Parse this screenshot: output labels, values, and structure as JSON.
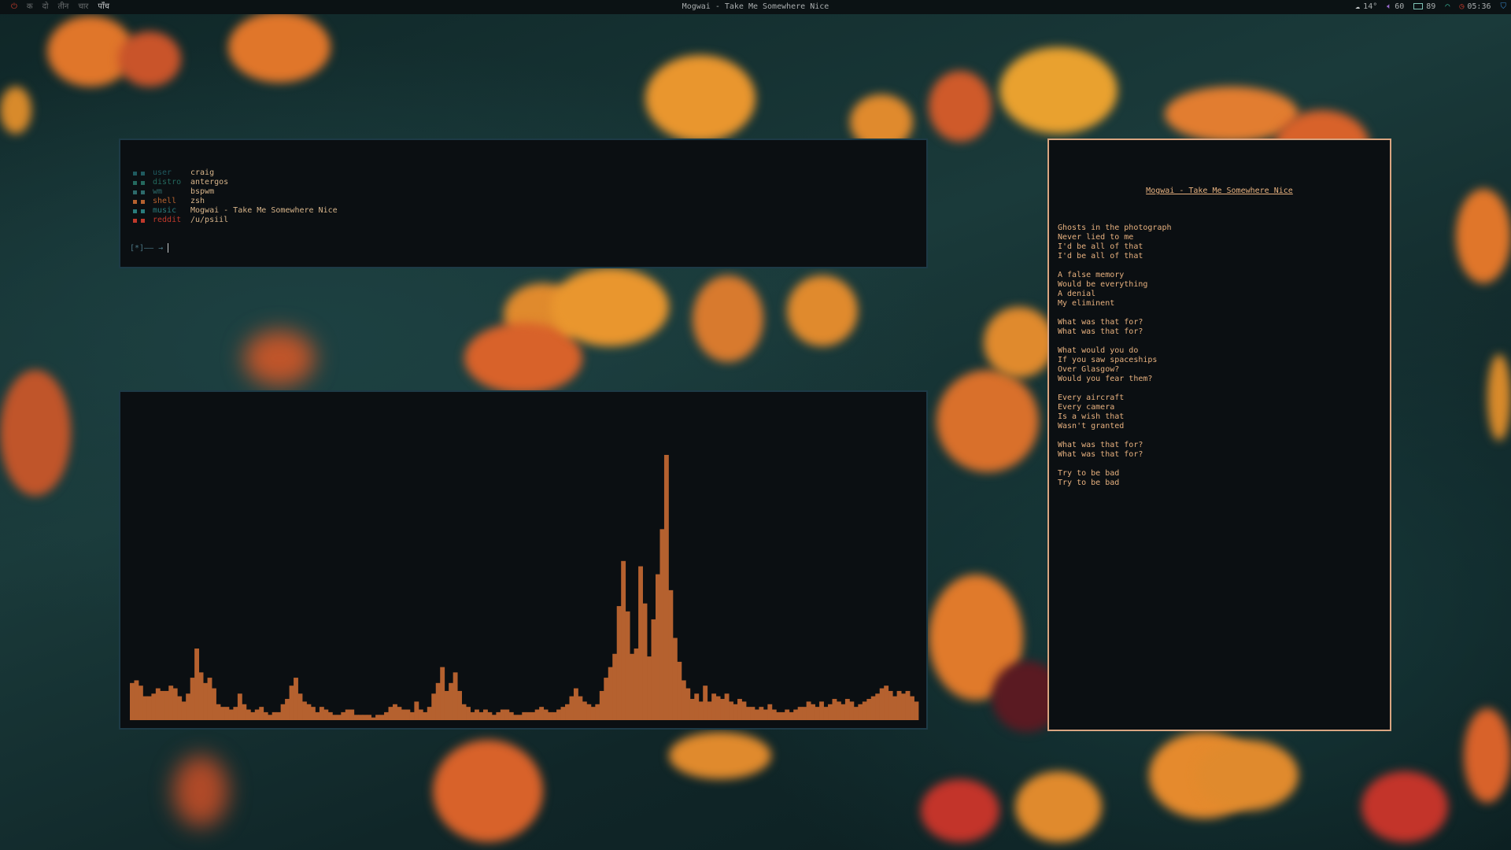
{
  "topbar": {
    "power_icon": "power-icon",
    "workspaces": [
      "क",
      "दो",
      "तीन",
      "चार",
      "पाँच"
    ],
    "active_workspace_index": 4,
    "now_playing": "Mogwai - Take Me Somewhere Nice",
    "weather": "14°",
    "volume": "60",
    "battery": "89",
    "time": "05:36"
  },
  "fetch": {
    "rows": [
      {
        "key": "user",
        "value": "craig",
        "color": "#1f5a5f"
      },
      {
        "key": "distro",
        "value": "antergos",
        "color": "#24695e"
      },
      {
        "key": "wm",
        "value": "bspwm",
        "color": "#2d6b6b"
      },
      {
        "key": "shell",
        "value": "zsh",
        "color": "#b5612f"
      },
      {
        "key": "music",
        "value": "Mogwai - Take Me Somewhere Nice",
        "color": "#2a7c7c"
      },
      {
        "key": "reddit",
        "value": "/u/psiil",
        "color": "#c0392b"
      }
    ],
    "prompt": "[*]—— →"
  },
  "visualizer": {
    "bar_color": "#b5612f",
    "levels": [
      0.14,
      0.15,
      0.13,
      0.09,
      0.09,
      0.1,
      0.12,
      0.11,
      0.11,
      0.13,
      0.12,
      0.09,
      0.07,
      0.1,
      0.16,
      0.27,
      0.18,
      0.14,
      0.16,
      0.12,
      0.06,
      0.05,
      0.05,
      0.04,
      0.05,
      0.1,
      0.06,
      0.04,
      0.03,
      0.04,
      0.05,
      0.03,
      0.02,
      0.03,
      0.03,
      0.06,
      0.08,
      0.13,
      0.16,
      0.1,
      0.07,
      0.06,
      0.05,
      0.03,
      0.05,
      0.04,
      0.03,
      0.02,
      0.02,
      0.03,
      0.04,
      0.04,
      0.02,
      0.02,
      0.02,
      0.02,
      0.01,
      0.02,
      0.02,
      0.03,
      0.05,
      0.06,
      0.05,
      0.04,
      0.04,
      0.03,
      0.07,
      0.04,
      0.03,
      0.05,
      0.1,
      0.14,
      0.2,
      0.11,
      0.14,
      0.18,
      0.11,
      0.06,
      0.05,
      0.03,
      0.04,
      0.03,
      0.04,
      0.03,
      0.02,
      0.03,
      0.04,
      0.04,
      0.03,
      0.02,
      0.02,
      0.03,
      0.03,
      0.03,
      0.04,
      0.05,
      0.04,
      0.03,
      0.03,
      0.04,
      0.05,
      0.06,
      0.09,
      0.12,
      0.09,
      0.07,
      0.06,
      0.05,
      0.06,
      0.11,
      0.16,
      0.2,
      0.25,
      0.43,
      0.6,
      0.41,
      0.25,
      0.27,
      0.58,
      0.44,
      0.24,
      0.38,
      0.55,
      0.72,
      1.0,
      0.49,
      0.31,
      0.22,
      0.15,
      0.12,
      0.08,
      0.1,
      0.07,
      0.13,
      0.07,
      0.1,
      0.09,
      0.08,
      0.1,
      0.07,
      0.06,
      0.08,
      0.07,
      0.05,
      0.05,
      0.04,
      0.05,
      0.04,
      0.06,
      0.04,
      0.03,
      0.03,
      0.04,
      0.03,
      0.04,
      0.05,
      0.05,
      0.07,
      0.06,
      0.05,
      0.07,
      0.05,
      0.06,
      0.08,
      0.07,
      0.06,
      0.08,
      0.07,
      0.05,
      0.06,
      0.07,
      0.08,
      0.09,
      0.1,
      0.12,
      0.13,
      0.11,
      0.09,
      0.11,
      0.1,
      0.11,
      0.09,
      0.07
    ]
  },
  "lyrics": {
    "title": "Mogwai - Take Me Somewhere Nice",
    "lines": [
      "Ghosts in the photograph",
      "Never lied to me",
      "I'd be all of that",
      "I'd be all of that",
      "",
      "A false memory",
      "Would be everything",
      "A denial",
      "My eliminent",
      "",
      "What was that for?",
      "What was that for?",
      "",
      "What would you do",
      "If you saw spaceships",
      "Over Glasgow?",
      "Would you fear them?",
      "",
      "Every aircraft",
      "Every camera",
      "Is a wish that",
      "Wasn't granted",
      "",
      "What was that for?",
      "What was that for?",
      "",
      "Try to be bad",
      "Try to be bad"
    ]
  }
}
